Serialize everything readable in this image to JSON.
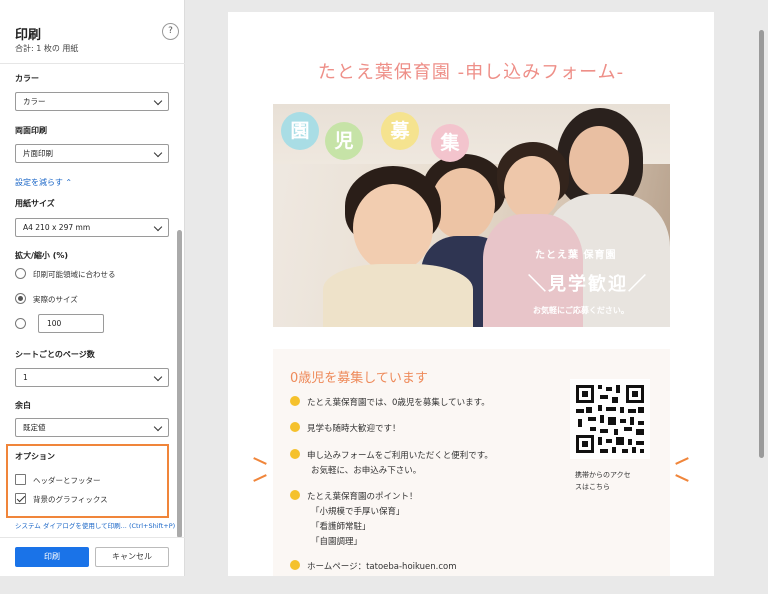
{
  "panel": {
    "title": "印刷",
    "subtitle": "合計: 1 枚の 用紙",
    "help": "?",
    "color": {
      "label": "カラー",
      "value": "カラー"
    },
    "duplex": {
      "label": "両面印刷",
      "value": "片面印刷"
    },
    "less_settings": "設定を減らす ⌃",
    "paper": {
      "label": "用紙サイズ",
      "value": "A4 210 x 297 mm"
    },
    "scale": {
      "label": "拡大/縮小 (%)",
      "options": [
        "印刷可能領域に合わせる",
        "実際のサイズ"
      ],
      "custom_value": "100"
    },
    "pages_per_sheet": {
      "label": "シートごとのページ数",
      "value": "1"
    },
    "margins": {
      "label": "余白",
      "value": "既定値"
    },
    "options": {
      "label": "オプション",
      "header_footer": "ヘッダーとフッター",
      "background": "背景のグラフィックス"
    },
    "system_dialog": "システム ダイアログを使用して印刷... (Ctrl+Shift+P)",
    "print_button": "印刷",
    "cancel_button": "キャンセル"
  },
  "preview": {
    "page_title": "たとえ葉保育園 -申し込みフォーム-",
    "photo": {
      "bubbles": [
        "園",
        "児",
        "募",
        "集"
      ],
      "school_name": "たとえ葉 保育園",
      "headline": "＼見学歓迎／",
      "subline": "お気軽にご応募ください。"
    },
    "info": {
      "heading": "0歳児を募集しています",
      "items": [
        "たとえ葉保育園では、0歳児を募集しています。",
        "見学も随時大歓迎です！",
        "申し込みフォームをご利用いただくと便利です。",
        "たとえ葉保育園のポイント！",
        "ホームページ：tatoeba-hoikuen.com"
      ],
      "sub_lines": [
        "お気軽に、お申込み下さい。",
        "「小規模で手厚い保育」",
        "「看護師常駐」",
        "「自園調理」"
      ],
      "qr_caption_1": "携帯からのアクセ",
      "qr_caption_2": "スはこちら"
    }
  },
  "colors": {
    "accent": "#f0853a",
    "title_pink": "#ee8f88",
    "primary_button": "#1a73e8"
  }
}
